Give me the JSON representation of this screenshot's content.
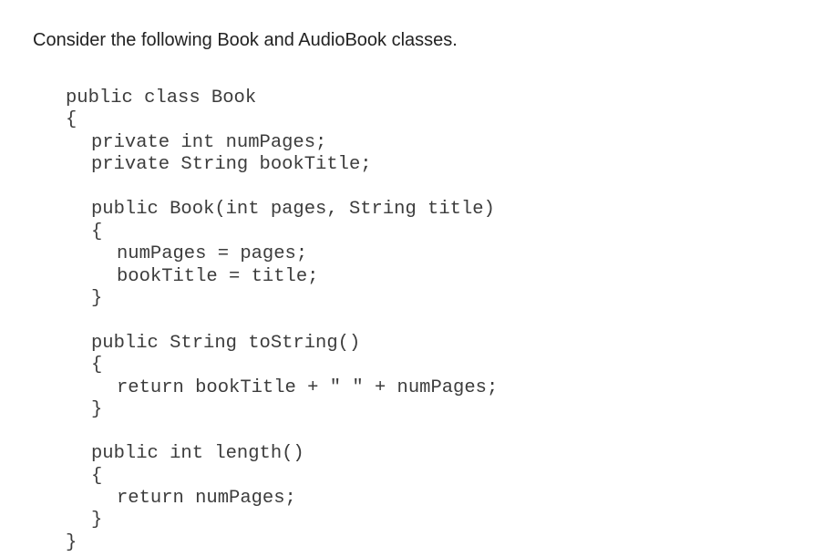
{
  "intro": {
    "text": "Consider the following Book and AudioBook classes."
  },
  "code": {
    "lines": [
      "public class Book",
      "{",
      "private int numPages;",
      "private String bookTitle;",
      "public Book(int pages, String title)",
      "{",
      "numPages = pages;",
      "bookTitle = title;",
      "}",
      "public String toString()",
      "{",
      "return bookTitle + \" \" + numPages;",
      "}",
      "public int length()",
      "{",
      "return numPages;",
      "}",
      "}"
    ]
  }
}
